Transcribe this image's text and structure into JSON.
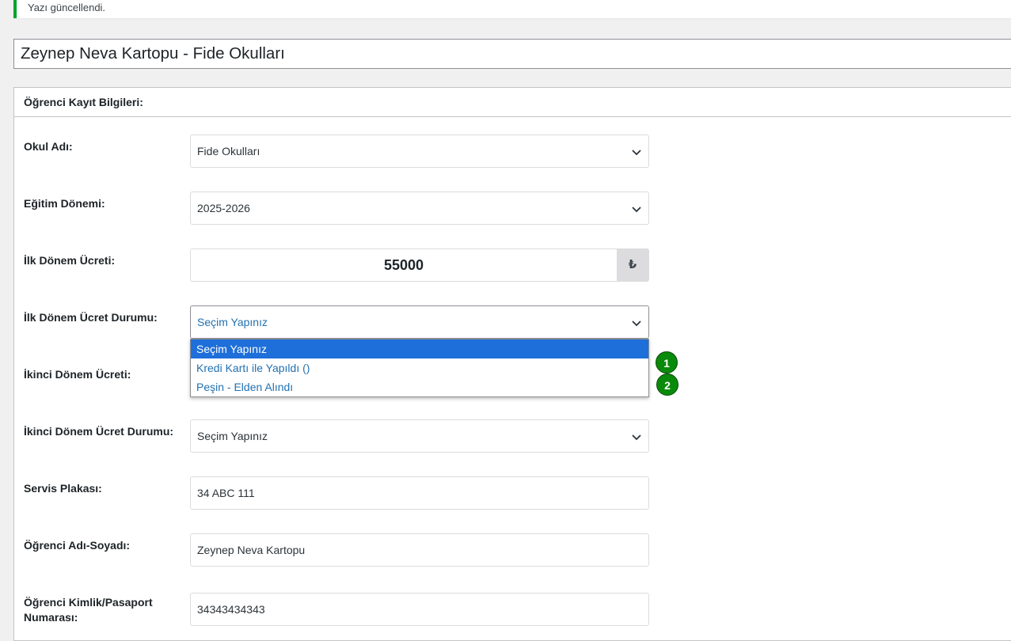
{
  "notice": {
    "text": "Yazı güncellendi."
  },
  "post": {
    "title": "Zeynep Neva Kartopu - Fide Okulları"
  },
  "metabox": {
    "header": "Öğrenci Kayıt Bilgileri:",
    "fields": {
      "school": {
        "label": "Okul Adı:",
        "value": "Fide Okulları"
      },
      "term": {
        "label": "Eğitim Dönemi:",
        "value": "2025-2026"
      },
      "first_fee": {
        "label": "İlk Dönem Ücreti:",
        "value": "55000",
        "currency": "₺"
      },
      "first_fee_status": {
        "label": "İlk Dönem Ücret Durumu:",
        "value": "Seçim Yapınız"
      },
      "second_fee": {
        "label": "İkinci Dönem Ücreti:"
      },
      "second_fee_status": {
        "label": "İkinci Dönem Ücret Durumu:",
        "value": "Seçim Yapınız"
      },
      "service_plate": {
        "label": "Servis Plakası:",
        "value": "34 ABC 111"
      },
      "student_name": {
        "label": "Öğrenci Adı-Soyadı:",
        "value": "Zeynep Neva Kartopu"
      },
      "student_id": {
        "label": "Öğrenci Kimlik/Pasaport Numarası:",
        "value": "34343434343"
      }
    }
  },
  "dropdown": {
    "options": [
      "Seçim Yapınız",
      "Kredi Kartı ile Yapıldı ()",
      "Peşin - Elden Alındı"
    ],
    "selected_index": 0
  },
  "badges": [
    "1",
    "2"
  ],
  "colors": {
    "accent": "#2271b1",
    "highlight": "#1e6fd9",
    "notice_border": "#00a32a",
    "badge": "#0a8a0a"
  }
}
